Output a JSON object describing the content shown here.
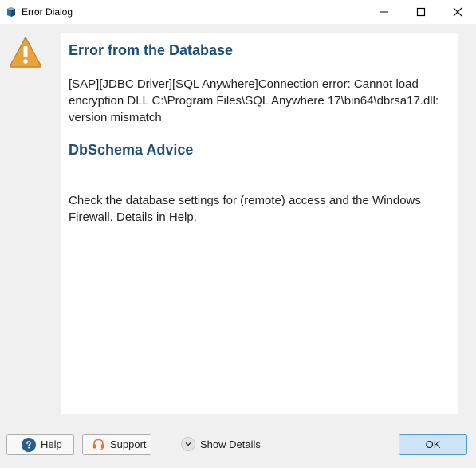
{
  "window": {
    "title": "Error Dialog"
  },
  "error": {
    "heading": "Error from the Database",
    "message": "[SAP][JDBC Driver][SQL Anywhere]Connection error: Cannot load encryption DLL C:\\Program Files\\SQL Anywhere 17\\bin64\\dbrsa17.dll: version mismatch"
  },
  "advice": {
    "heading": "DbSchema Advice",
    "message": "Check the database settings for (remote) access and the Windows Firewall. Details in Help."
  },
  "buttons": {
    "help": "Help",
    "support": "Support",
    "show_details": "Show Details",
    "ok": "OK"
  },
  "icons": {
    "app": "app-icon",
    "warning": "warning-icon",
    "help": "help-icon",
    "support": "headset-icon",
    "details": "chevron-down-icon"
  },
  "colors": {
    "heading": "#1d4f73",
    "warning": "#e8a33a",
    "help_icon": "#2b5d8a",
    "support_icon": "#e87030",
    "ok_bg": "#cde5f7",
    "ok_border": "#4c9bd6"
  }
}
